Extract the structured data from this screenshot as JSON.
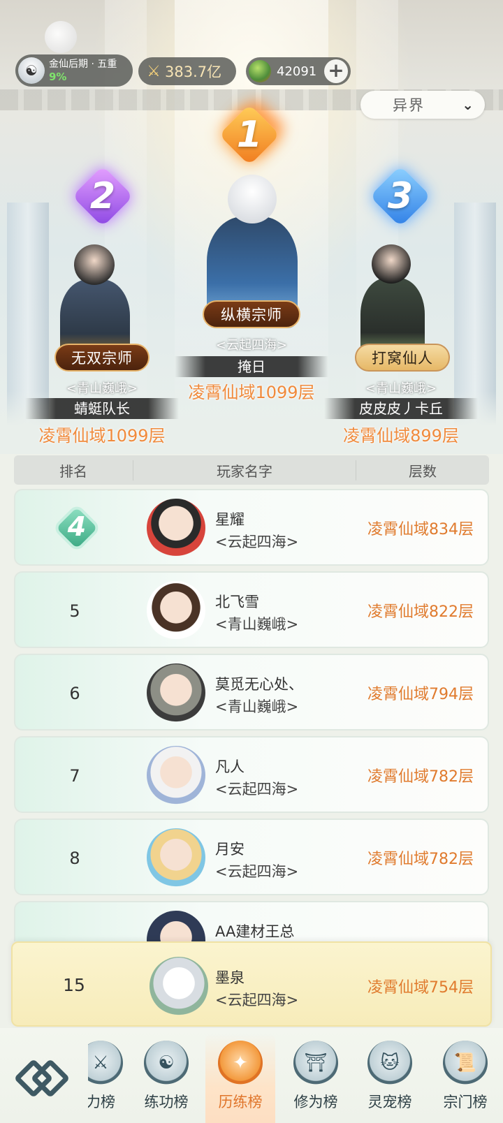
{
  "header": {
    "realm": "金仙后期 · 五重",
    "realm_percent": "9%",
    "combat_power": "383.7亿",
    "currency": "42091",
    "plus_label": "+"
  },
  "filter": {
    "selected": "异界"
  },
  "podium": [
    {
      "rank": "1",
      "title": "纵横宗师",
      "guild": "<云起四海>",
      "name": "掩日",
      "floor": "凌霄仙域1099层"
    },
    {
      "rank": "2",
      "title": "无双宗师",
      "guild": "<青山巍峨>",
      "name": "蜻蜓队长",
      "floor": "凌霄仙域1099层"
    },
    {
      "rank": "3",
      "title": "打窝仙人",
      "guild": "<青山巍峨>",
      "name": "皮皮皮丿卡丘",
      "floor": "凌霄仙域899层"
    }
  ],
  "table": {
    "columns": [
      "排名",
      "玩家名字",
      "层数"
    ],
    "rows": [
      {
        "rank": "4",
        "name": "星耀",
        "guild": "<云起四海>",
        "floor": "凌霄仙域834层"
      },
      {
        "rank": "5",
        "name": "北飞雪",
        "guild": "<青山巍峨>",
        "floor": "凌霄仙域822层"
      },
      {
        "rank": "6",
        "name": "莫觅无心处、",
        "guild": "<青山巍峨>",
        "floor": "凌霄仙域794层"
      },
      {
        "rank": "7",
        "name": "凡人",
        "guild": "<云起四海>",
        "floor": "凌霄仙域782层"
      },
      {
        "rank": "8",
        "name": "月安",
        "guild": "<云起四海>",
        "floor": "凌霄仙域782层"
      }
    ],
    "partial_row_name": "AA建材王总"
  },
  "self_row": {
    "rank": "15",
    "name": "墨泉",
    "guild": "<云起四海>",
    "floor": "凌霄仙域754层"
  },
  "nav": {
    "tabs": [
      {
        "label": "力榜",
        "icon": "sword-icon"
      },
      {
        "label": "练功榜",
        "icon": "yin-yang-icon"
      },
      {
        "label": "历练榜",
        "icon": "star-icon"
      },
      {
        "label": "修为榜",
        "icon": "hat-icon"
      },
      {
        "label": "灵宠榜",
        "icon": "cat-icon"
      },
      {
        "label": "宗门榜",
        "icon": "scroll-icon"
      }
    ]
  },
  "colors": {
    "accent": "#e07b2e",
    "active_tab": "#e0752b",
    "row_highlight": "#dff3e9",
    "self_row": "#f7ecba"
  }
}
